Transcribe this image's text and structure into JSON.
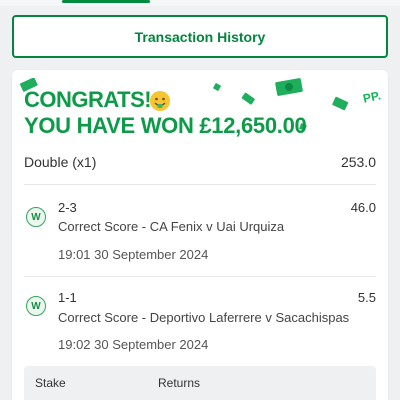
{
  "header": {
    "transaction_history_label": "Transaction History"
  },
  "banner": {
    "line1": "CONGRATS!",
    "line2": "YOU HAVE WON £12,650.00",
    "tag": "PP.",
    "colors": {
      "text": "#0d9a49",
      "money": "#1fae5c"
    }
  },
  "bet": {
    "type": "Double (x1)",
    "total_odds": "253.0",
    "legs": [
      {
        "status_icon": "W",
        "score": "2-3",
        "odds": "46.0",
        "market": "Correct Score - CA Fenix v Uai Urquiza",
        "time": "19:01 30 September 2024"
      },
      {
        "status_icon": "W",
        "score": "1-1",
        "odds": "5.5",
        "market": "Correct Score - Deportivo Laferrere v Sacachispas",
        "time": "19:02 30 September 2024"
      }
    ]
  },
  "summary": {
    "stake_label": "Stake",
    "returns_label": "Returns"
  },
  "colors": {
    "accent": "#05833f",
    "win_badge": "#36a55f"
  }
}
